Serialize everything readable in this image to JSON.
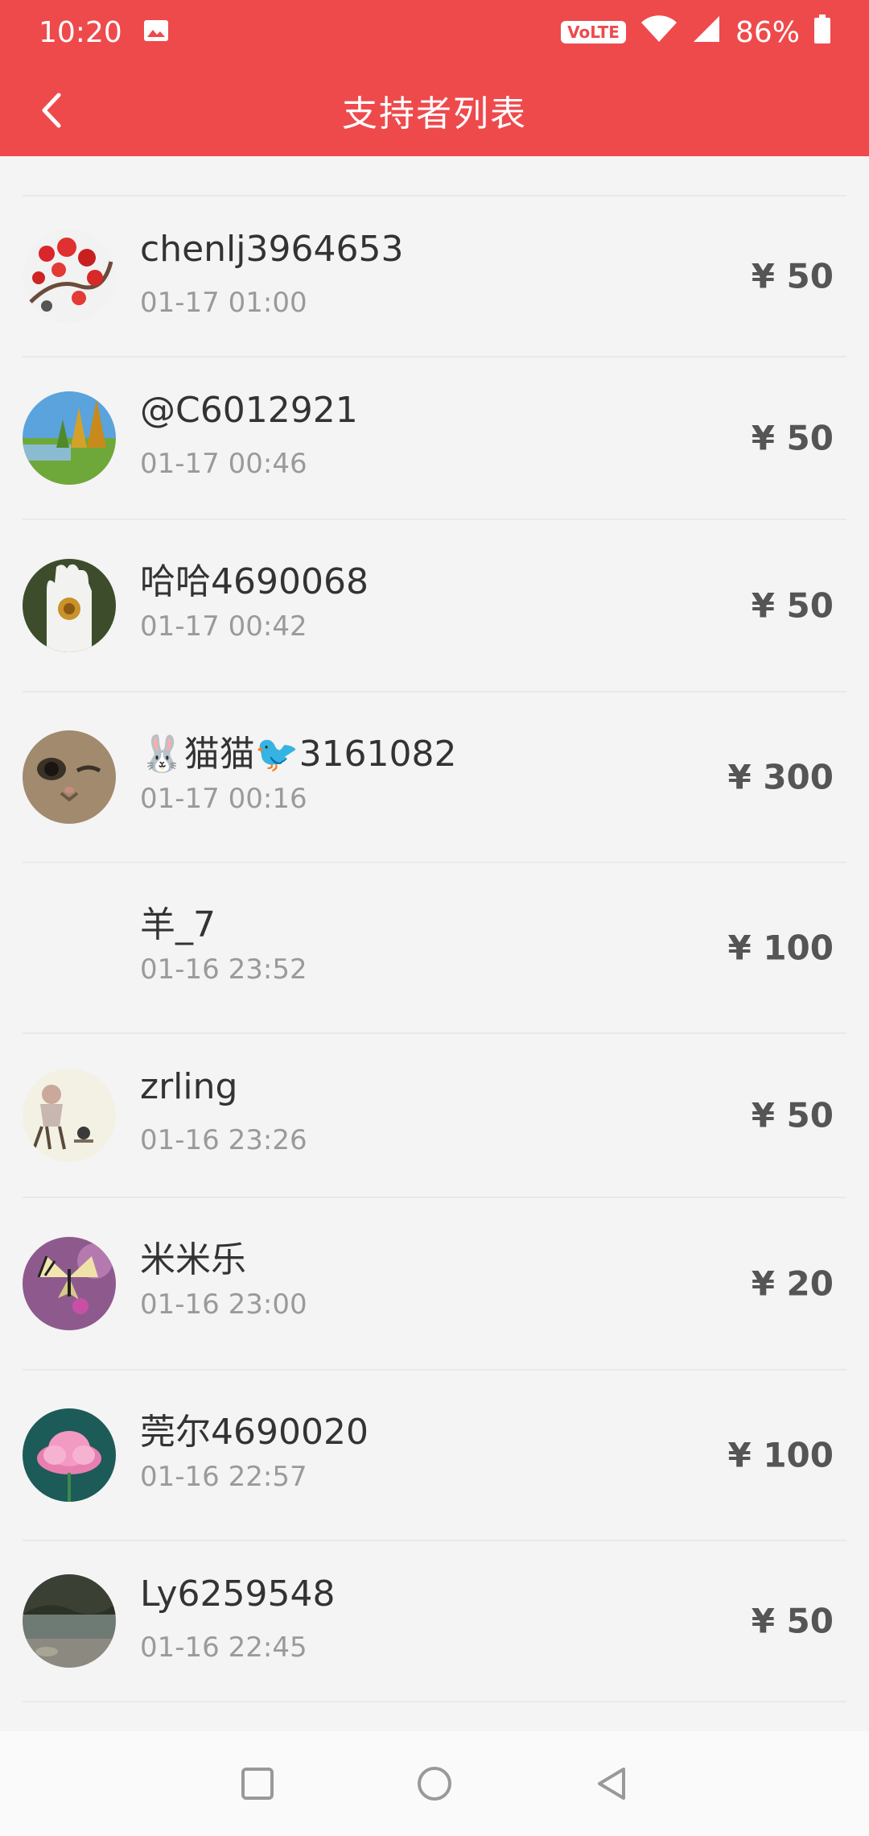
{
  "status_bar": {
    "time": "10:20",
    "volte": "VoLTE",
    "battery": "86%",
    "icons": [
      "image-icon",
      "wifi-icon",
      "signal-icon",
      "battery-icon"
    ]
  },
  "header": {
    "title": "支持者列表",
    "back_icon": "chevron-left-icon",
    "bg_color": "#ee4a4c"
  },
  "supporters": [
    {
      "name": "chenlj3964653",
      "time": "01-17 01:00",
      "amount": "¥ 50",
      "avatar": "plum-blossom"
    },
    {
      "name": "@C6012921",
      "time": "01-17 00:46",
      "amount": "¥ 50",
      "avatar": "landscape-trees"
    },
    {
      "name": "哈哈4690068",
      "time": "01-17 00:42",
      "amount": "¥ 50",
      "avatar": "hand"
    },
    {
      "name": "🐰猫猫🐦3161082",
      "time": "01-17 00:16",
      "amount": "¥ 300",
      "avatar": "cat-face"
    },
    {
      "name": "羊_7",
      "time": "01-16 23:52",
      "amount": "¥ 100",
      "avatar": "none"
    },
    {
      "name": "zrling",
      "time": "01-16 23:26",
      "amount": "¥ 50",
      "avatar": "sitting-figure"
    },
    {
      "name": "米米乐",
      "time": "01-16 23:00",
      "amount": "¥ 20",
      "avatar": "butterfly"
    },
    {
      "name": "莞尔4690020",
      "time": "01-16 22:57",
      "amount": "¥ 100",
      "avatar": "lotus"
    },
    {
      "name": "Ly6259548",
      "time": "01-16 22:45",
      "amount": "¥ 50",
      "avatar": "river"
    }
  ],
  "nav_bar": {
    "buttons": [
      "recents-square-icon",
      "home-circle-icon",
      "back-triangle-icon"
    ]
  }
}
